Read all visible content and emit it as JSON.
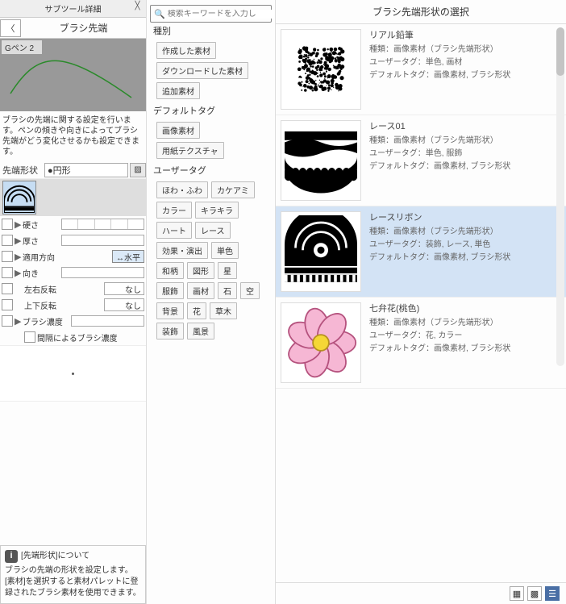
{
  "leftPanel": {
    "title": "サブツール詳細",
    "navTitle": "ブラシ先端",
    "brushName": "Gペン 2",
    "description": "ブラシの先端に関する設定を行います。ペンの傾きや向きによってブラシ先端がどう変化させるかも設定できます。",
    "shapeLabel": "先端形状",
    "shapeValue": "●円形",
    "sliders": {
      "hardness": "硬さ",
      "thickness": "厚さ",
      "direction": "適用方向",
      "dirValue": "↔水平",
      "orient": "向き",
      "flipH": "左右反転",
      "flipV": "上下反転",
      "none": "なし",
      "density": "ブラシ濃度",
      "gap": "間隔によるブラシ濃度"
    },
    "info": {
      "title": "[先端形状]について",
      "body1": "ブラシの先端の形状を設定します。",
      "body2": "[素材]を選択すると素材パレットに登録されたブラシ素材を使用できます。"
    }
  },
  "middlePanel": {
    "searchPlaceholder": "検索キーワードを入力し",
    "sections": [
      {
        "header": "種別",
        "tags": [
          "作成した素材",
          "ダウンロードした素材",
          "追加素材"
        ]
      },
      {
        "header": "デフォルトタグ",
        "tags": [
          "画像素材",
          "用紙テクスチャ"
        ]
      },
      {
        "header": "ユーザータグ",
        "tags": [
          "ほわ・ふわ",
          "カケアミ",
          "カラー",
          "キラキラ",
          "ハート",
          "レース",
          "効果・演出",
          "単色",
          "和柄",
          "図形",
          "星",
          "服飾",
          "画材",
          "石",
          "空",
          "背景",
          "花",
          "草木",
          "装飾",
          "風景"
        ]
      }
    ]
  },
  "rightPanel": {
    "title": "ブラシ先端形状の選択",
    "items": [
      {
        "name": "リアル鉛筆",
        "type": "種類：画像素材（ブラシ先端形状）",
        "user": "ユーザータグ：単色, 画材",
        "def": "デフォルトタグ：画像素材, ブラシ形状"
      },
      {
        "name": "レース01",
        "type": "種類：画像素材（ブラシ先端形状）",
        "user": "ユーザータグ：単色, 服飾",
        "def": "デフォルトタグ：画像素材, ブラシ形状"
      },
      {
        "name": "レースリボン",
        "type": "種類：画像素材（ブラシ先端形状）",
        "user": "ユーザータグ：装飾, レース, 単色",
        "def": "デフォルトタグ：画像素材, ブラシ形状"
      },
      {
        "name": "七弁花(桃色)",
        "type": "種類：画像素材（ブラシ先端形状）",
        "user": "ユーザータグ：花, カラー",
        "def": "デフォルトタグ：画像素材, ブラシ形状"
      }
    ]
  }
}
